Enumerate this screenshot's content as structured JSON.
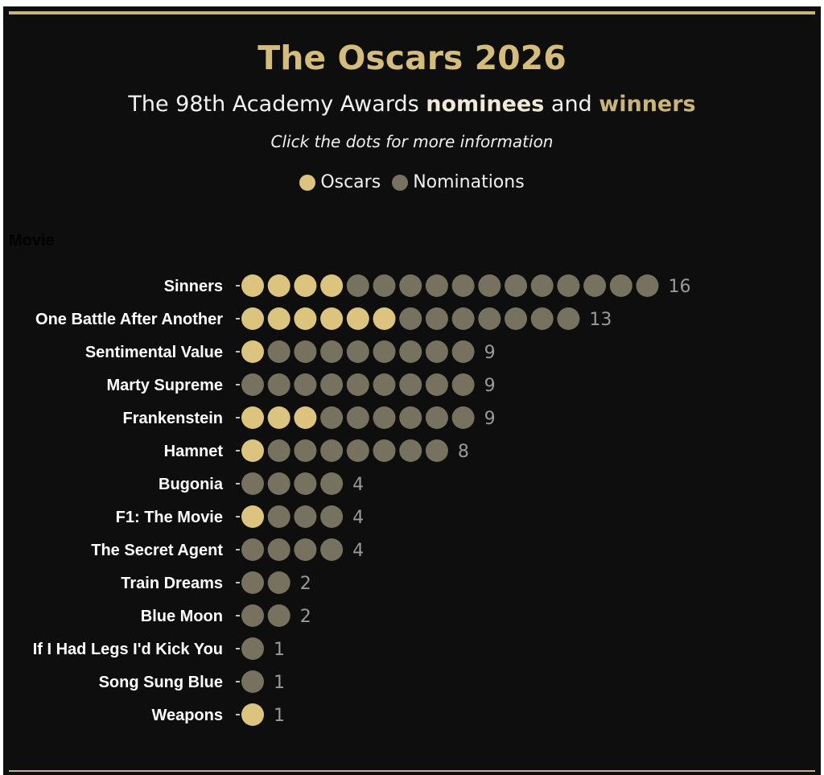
{
  "header": {
    "title": "The Oscars 2026",
    "subtitle_pre": "The 98th Academy Awards ",
    "subtitle_nominees": "nominees",
    "subtitle_mid": " and ",
    "subtitle_winners": "winners",
    "hint": "Click the dots for more information"
  },
  "legend": {
    "oscars_label": "Oscars",
    "nominations_label": "Nominations"
  },
  "colors": {
    "oscar": "#dcc47e",
    "nomination": "#77725f",
    "background": "#0e0e0e",
    "accent": "#c9b47a"
  },
  "chart_data": {
    "type": "dot-plot",
    "ylabel": "Movie",
    "series": [
      {
        "name": "Oscars"
      },
      {
        "name": "Nominations"
      }
    ],
    "rows": [
      {
        "movie": "Sinners",
        "oscars": 4,
        "nominations": 16
      },
      {
        "movie": "One Battle After Another",
        "oscars": 6,
        "nominations": 13
      },
      {
        "movie": "Sentimental Value",
        "oscars": 1,
        "nominations": 9
      },
      {
        "movie": "Marty Supreme",
        "oscars": 0,
        "nominations": 9
      },
      {
        "movie": "Frankenstein",
        "oscars": 3,
        "nominations": 9
      },
      {
        "movie": "Hamnet",
        "oscars": 1,
        "nominations": 8
      },
      {
        "movie": "Bugonia",
        "oscars": 0,
        "nominations": 4
      },
      {
        "movie": "F1: The Movie",
        "oscars": 1,
        "nominations": 4
      },
      {
        "movie": "The Secret Agent",
        "oscars": 0,
        "nominations": 4
      },
      {
        "movie": "Train Dreams",
        "oscars": 0,
        "nominations": 2
      },
      {
        "movie": "Blue Moon",
        "oscars": 0,
        "nominations": 2
      },
      {
        "movie": "If I Had Legs I'd Kick You",
        "oscars": 0,
        "nominations": 1
      },
      {
        "movie": "Song Sung Blue",
        "oscars": 0,
        "nominations": 1
      },
      {
        "movie": "Weapons",
        "oscars": 1,
        "nominations": 1
      }
    ]
  }
}
